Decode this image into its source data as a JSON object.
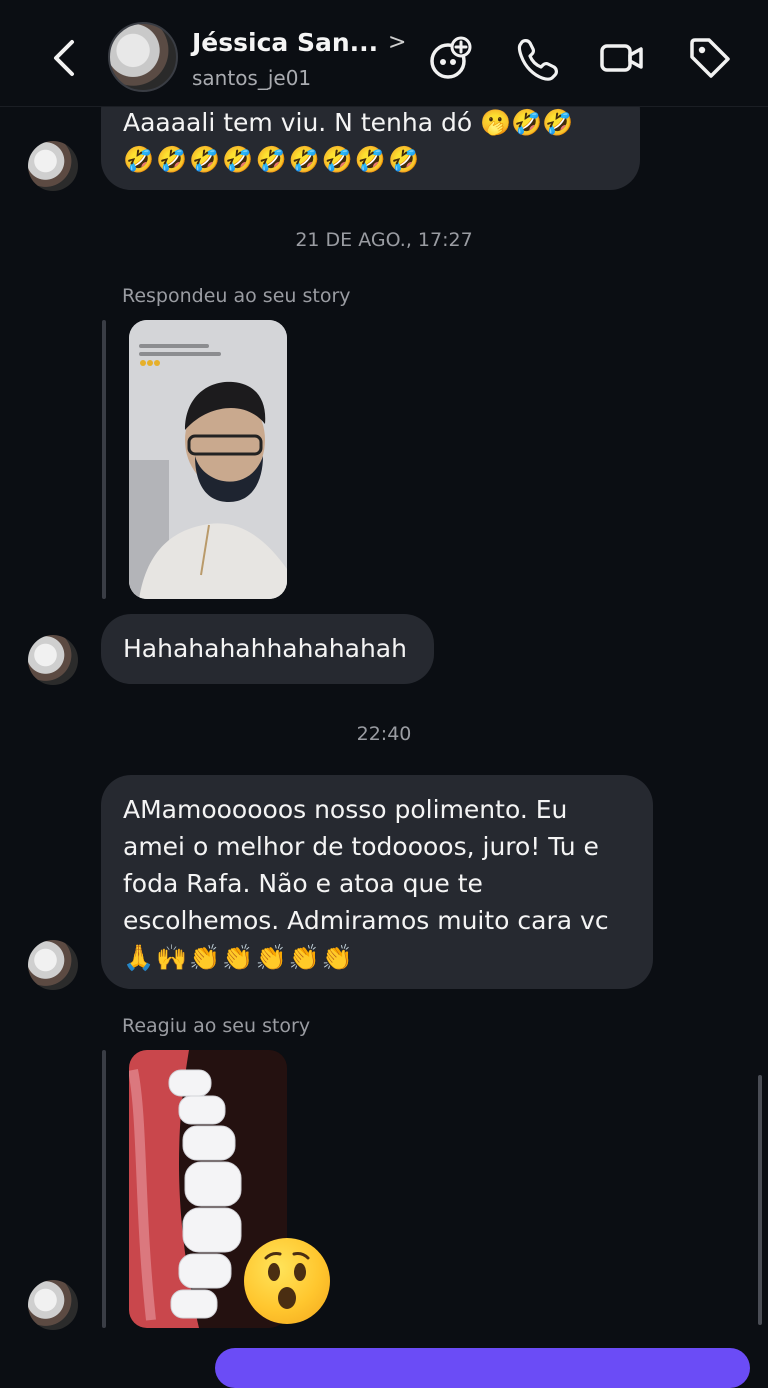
{
  "header": {
    "name": "Jéssica San...",
    "username": "santos_je01",
    "chevron": ">"
  },
  "messages": {
    "m1_line1": "Aaaaali tem viu. N tenha dó 🫢🤣🤣",
    "m1_line2": "🤣🤣🤣🤣🤣🤣🤣🤣🤣",
    "stamp1": "21 DE AGO., 17:27",
    "reply1_label": "Respondeu ao seu story",
    "m2": "Hahahahahhahahahah",
    "stamp2": "22:40",
    "m3_line1": "AMamoooooos nosso polimento. Eu",
    "m3_line2": "amei o melhor de todoooos, juro! Tu e",
    "m3_line3": "foda Rafa. Não e atoa que te",
    "m3_line4": "escolhemos. Admiramos muito cara vc",
    "m3_line5": "🙏🙌👏👏👏👏👏",
    "reply2_label": "Reagiu ao seu story",
    "reaction_emoji": "😮"
  },
  "colors": {
    "background": "#0b0e13",
    "bubble": "#262930",
    "accent": "#6b4cf6"
  },
  "icons": [
    "back-arrow-icon",
    "ai-sparkle-icon",
    "phone-icon",
    "video-camera-icon",
    "tag-icon"
  ]
}
